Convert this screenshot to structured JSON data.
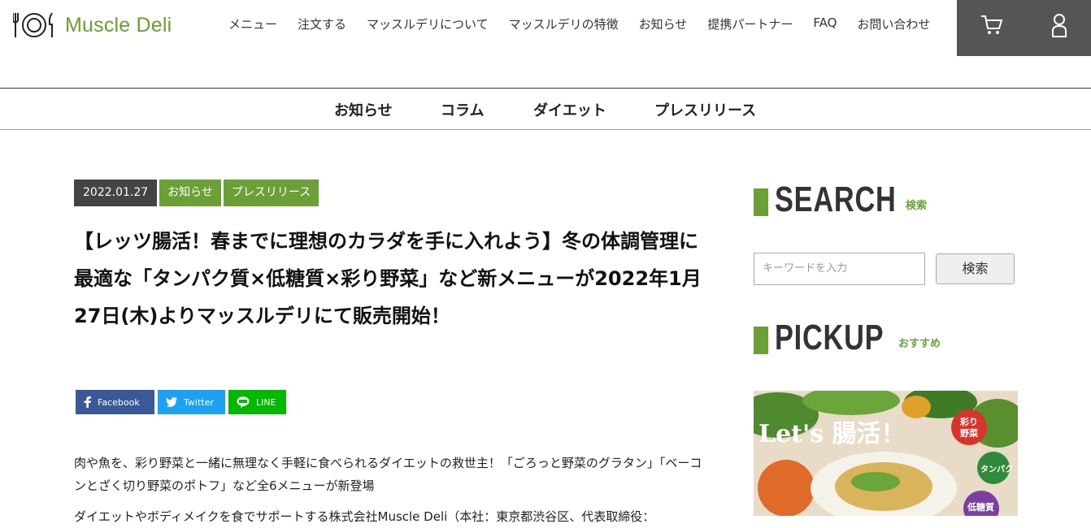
{
  "header": {
    "logo_text": "Muscle Deli",
    "nav": [
      "メニュー",
      "注文する",
      "マッスルデリについて",
      "マッスルデリの特徴",
      "お知らせ",
      "提携パートナー",
      "FAQ",
      "お問い合わせ"
    ]
  },
  "subnav": [
    "お知らせ",
    "コラム",
    "ダイエット",
    "プレスリリース"
  ],
  "article": {
    "date": "2022.01.27",
    "tags": [
      "お知らせ",
      "プレスリリース"
    ],
    "title": "【レッツ腸活！春までに理想のカラダを手に入れよう】冬の体調管理に最適な「タンパク質×低糖質×彩り野菜」など新メニューが2022年1月27日(木)よりマッスルデリにて販売開始！",
    "share": {
      "facebook": "Facebook",
      "twitter": "Twitter",
      "line": "LINE"
    },
    "paragraphs": [
      "肉や魚を、彩り野菜と一緒に無理なく手軽に食べられるダイエットの救世主！「ごろっと野菜のグラタン」「ベーコンとざく切り野菜のポトフ」など全6メニューが新登場",
      "ダイエットやボディメイクを食でサポートする株式会社Muscle Deli（本社：東京都渋谷区、代表取締役："
    ]
  },
  "sidebar": {
    "search_title": "SEARCH",
    "search_sub": "検索",
    "search_placeholder": "キーワードを入力",
    "search_button": "検索",
    "pickup_title": "PICKUP",
    "pickup_sub": "おすすめ",
    "pickup_image_text": {
      "headline": "Let's 腸活！",
      "badge1": "彩り野菜",
      "badge2": "タンパク",
      "badge3": "低糖質"
    }
  },
  "colors": {
    "accent": "#6aa036",
    "dark_box": "#555555",
    "facebook": "#3b5998",
    "twitter": "#1da1f2",
    "line": "#00b900"
  }
}
